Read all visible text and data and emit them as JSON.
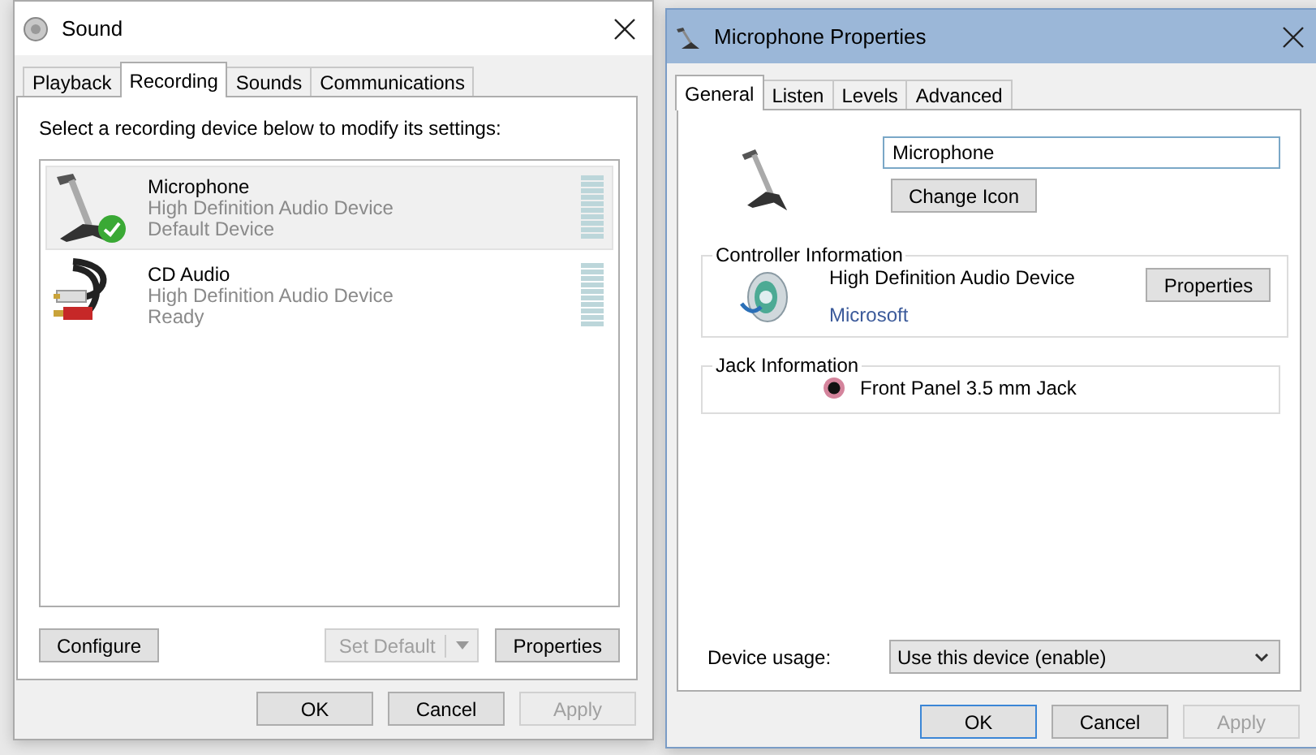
{
  "sound_window": {
    "title": "Sound",
    "tabs": [
      {
        "label": "Playback",
        "selected": false
      },
      {
        "label": "Recording",
        "selected": true
      },
      {
        "label": "Sounds",
        "selected": false
      },
      {
        "label": "Communications",
        "selected": false
      }
    ],
    "instruction": "Select a recording device below to modify its settings:",
    "devices": [
      {
        "name": "Microphone",
        "driver": "High Definition Audio Device",
        "status": "Default Device",
        "kind": "microphone",
        "selected": true,
        "default": true
      },
      {
        "name": "CD Audio",
        "driver": "High Definition Audio Device",
        "status": "Ready",
        "kind": "cd_audio",
        "selected": false,
        "default": false
      }
    ],
    "configure": {
      "label": "Configure",
      "disabled": false
    },
    "set_default": {
      "label": "Set Default",
      "disabled": true
    },
    "properties": {
      "label": "Properties",
      "disabled": false
    },
    "dialog_buttons": [
      {
        "label": "OK",
        "disabled": false,
        "default": false
      },
      {
        "label": "Cancel",
        "disabled": false,
        "default": false
      },
      {
        "label": "Apply",
        "disabled": true,
        "default": false
      }
    ]
  },
  "properties_window": {
    "title": "Microphone Properties",
    "tabs": [
      {
        "label": "General",
        "selected": true
      },
      {
        "label": "Listen",
        "selected": false
      },
      {
        "label": "Levels",
        "selected": false
      },
      {
        "label": "Advanced",
        "selected": false
      }
    ],
    "name_value": "Microphone",
    "change_icon": "Change Icon",
    "controller": {
      "heading": "Controller Information",
      "device": "High Definition Audio Device",
      "vendor": "Microsoft",
      "button": "Properties"
    },
    "jack": {
      "heading": "Jack Information",
      "name": "Front Panel 3.5 mm Jack",
      "color": "#d4849c"
    },
    "device_usage": {
      "label": "Device usage:",
      "value": "Use this device (enable)"
    },
    "dialog_buttons": [
      {
        "label": "OK",
        "disabled": false,
        "default": true
      },
      {
        "label": "Cancel",
        "disabled": false,
        "default": false
      },
      {
        "label": "Apply",
        "disabled": true,
        "default": false
      }
    ]
  }
}
